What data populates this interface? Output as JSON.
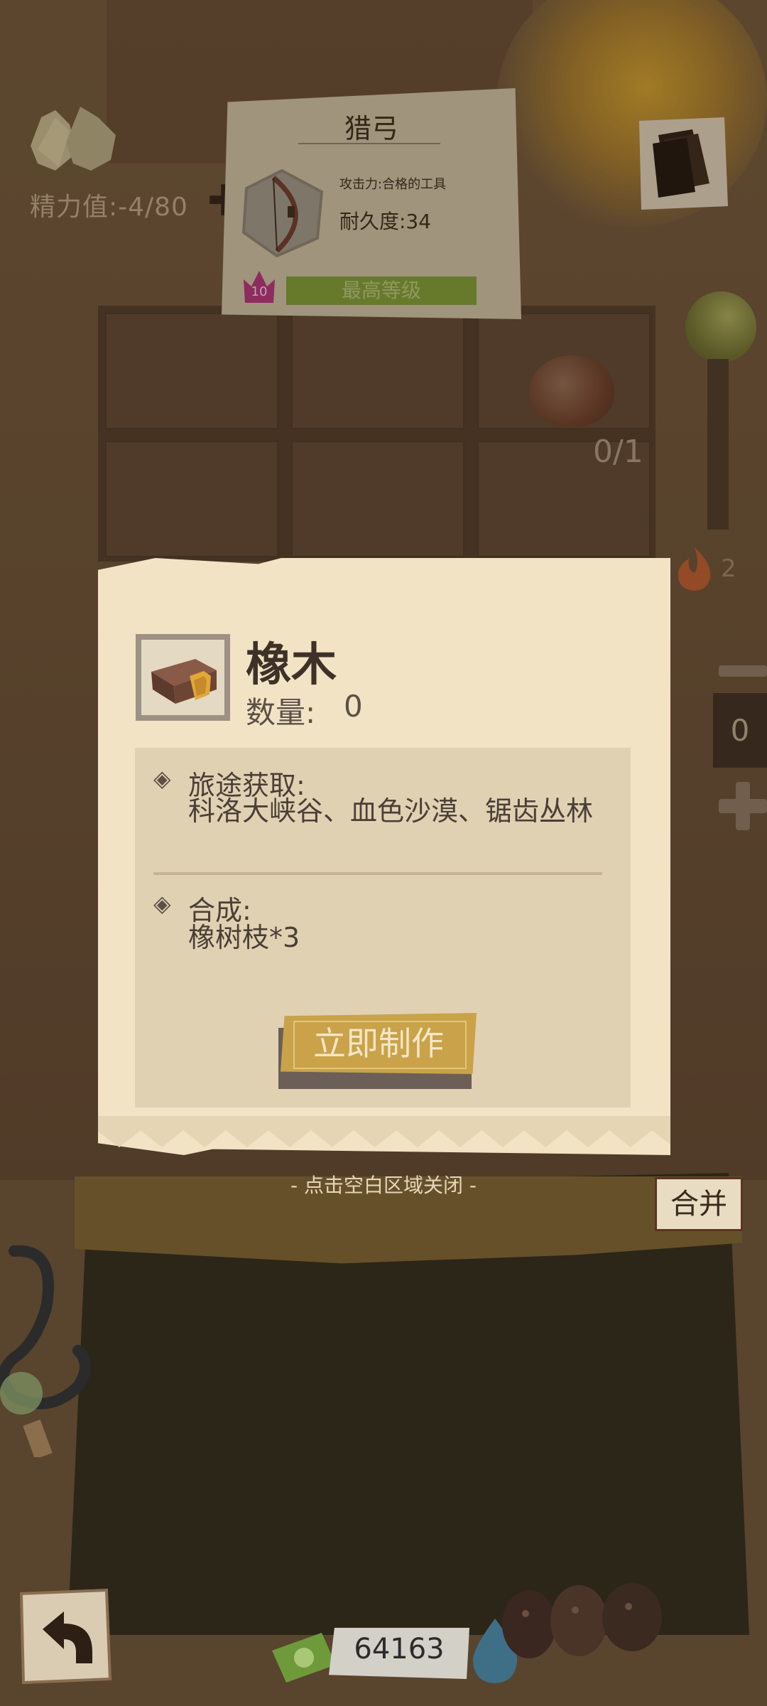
{
  "energy": {
    "label": "精力值:-4/80"
  },
  "item_card": {
    "title": "猎弓",
    "attack": "攻击力:合格的工具",
    "durability": "耐久度:34",
    "level": "10",
    "max_level": "最高等级"
  },
  "slot_counter": "0/1",
  "fire_count": "2",
  "quantity": "0",
  "material": {
    "name": "橡木",
    "qty_label": "数量:",
    "qty_value": "0",
    "source_heading": "旅途获取:",
    "source_text": "科洛大峡谷、血色沙漠、锯齿丛林",
    "craft_heading": "合成:",
    "craft_text": "橡树枝*3",
    "craft_button": "立即制作"
  },
  "close_hint": "- 点击空白区域关闭 -",
  "merge_button": "合并",
  "money": "64163",
  "colors": {
    "panel": "#f1e3c4",
    "button": "#c9a24a",
    "max_level_bar": "#7c9a36",
    "crown": "#b0307a"
  },
  "icons": [
    "energy-leaves-icon",
    "bow-icon",
    "crown-icon",
    "cards-icon",
    "orb-icon",
    "acorn-icon",
    "fire-icon",
    "log-icon",
    "hook-icon",
    "back-arrow-icon",
    "cash-icon",
    "blue-drop-icon"
  ]
}
